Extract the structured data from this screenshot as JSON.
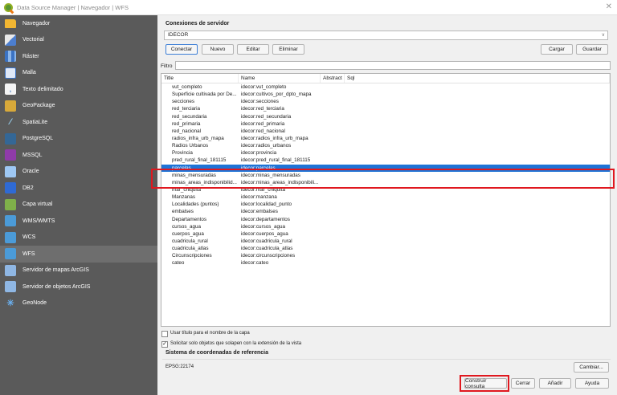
{
  "window": {
    "title": "Data Source Manager | Navegador | WFS"
  },
  "sidebar": {
    "items": [
      {
        "label": "Navegador",
        "icon": "folder-icon"
      },
      {
        "label": "Vectorial",
        "icon": "vector-icon"
      },
      {
        "label": "Ráster",
        "icon": "raster-icon"
      },
      {
        "label": "Malla",
        "icon": "mesh-icon"
      },
      {
        "label": "Texto delimitado",
        "icon": "delimited-text-icon"
      },
      {
        "label": "GeoPackage",
        "icon": "geopackage-icon"
      },
      {
        "label": "SpatiaLite",
        "icon": "spatialite-icon"
      },
      {
        "label": "PostgreSQL",
        "icon": "postgresql-icon"
      },
      {
        "label": "MSSQL",
        "icon": "mssql-icon"
      },
      {
        "label": "Oracle",
        "icon": "oracle-icon"
      },
      {
        "label": "DB2",
        "icon": "db2-icon"
      },
      {
        "label": "Capa virtual",
        "icon": "virtual-layer-icon"
      },
      {
        "label": "WMS/WMTS",
        "icon": "wms-icon"
      },
      {
        "label": "WCS",
        "icon": "wcs-icon"
      },
      {
        "label": "WFS",
        "icon": "wfs-icon"
      },
      {
        "label": "Servidor de mapas ArcGIS",
        "icon": "arcgis-map-server-icon"
      },
      {
        "label": "Servidor de objetos ArcGIS",
        "icon": "arcgis-feature-server-icon"
      },
      {
        "label": "GeoNode",
        "icon": "geonode-icon"
      }
    ]
  },
  "connections": {
    "title": "Conexiones de servidor",
    "selected": "IDECOR",
    "buttons": {
      "connect": "Conectar",
      "new": "Nuevo",
      "edit": "Editar",
      "delete": "Eliminar",
      "load": "Cargar",
      "save": "Guardar"
    }
  },
  "filter": {
    "label": "Filtro",
    "value": ""
  },
  "table": {
    "headers": [
      "Title",
      "Name",
      "Abstract",
      "Sql"
    ],
    "rows": [
      [
        "vut_completo",
        "idecor:vut_completo"
      ],
      [
        "Superficie cultivada por De...",
        "idecor:cultivos_por_dpto_mapa"
      ],
      [
        "secciones",
        "idecor:secciones"
      ],
      [
        "red_terciaria",
        "idecor:red_terciaria"
      ],
      [
        "red_secundaria",
        "idecor:red_secundaria"
      ],
      [
        "red_primaria",
        "idecor:red_primaria"
      ],
      [
        "red_nacional",
        "idecor:red_nacional"
      ],
      [
        "radios_infra_urb_mapa",
        "idecor:radios_infra_urb_mapa"
      ],
      [
        "Radios Urbanos",
        "idecor:radios_urbanos"
      ],
      [
        "Provincia",
        "idecor:provincia"
      ],
      [
        "pred_rural_final_181115",
        "idecor:pred_rural_final_181115"
      ],
      [
        "parcelas",
        "idecor:parcelas"
      ],
      [
        "minas_mensuradas",
        "idecor:minas_mensuradas"
      ],
      [
        "minas_areas_indisponibilid...",
        "idecor:minas_areas_indisponibili..."
      ],
      [
        "mar_chiquita",
        "idecor:mar_chiquita"
      ],
      [
        "Manzanas",
        "idecor:manzana"
      ],
      [
        "Localidades (puntos)",
        "idecor:localidad_punto"
      ],
      [
        "embalses",
        "idecor:embalses"
      ],
      [
        "Departamentos",
        "idecor:departamentos"
      ],
      [
        "cursos_agua",
        "idecor:cursos_agua"
      ],
      [
        "cuerpos_agua",
        "idecor:cuerpos_agua"
      ],
      [
        "cuadricula_rural",
        "idecor:cuadricula_rural"
      ],
      [
        "cuadricula_atlas",
        "idecor:cuadricula_atlas"
      ],
      [
        "Circunscripciones",
        "idecor:circunscripciones"
      ],
      [
        "cateo",
        "idecor:cateo"
      ]
    ],
    "selected_row": "parcelas"
  },
  "options": {
    "use_title": "Usar título para el nombre de la capa",
    "only_extent": "Solicitar solo objetos que solapen con la extensión de la vista"
  },
  "crs": {
    "title": "Sistema de coordenadas de referencia",
    "value": "EPSG:22174",
    "change": "Cambiar..."
  },
  "footer": {
    "build_query": "Construir consulta",
    "close": "Cerrar",
    "add": "Añadir",
    "help": "Ayuda"
  },
  "colors": {
    "sidebar_bg": "#5a5a5a",
    "selection": "#1e73d6",
    "highlight": "#e0181f"
  }
}
